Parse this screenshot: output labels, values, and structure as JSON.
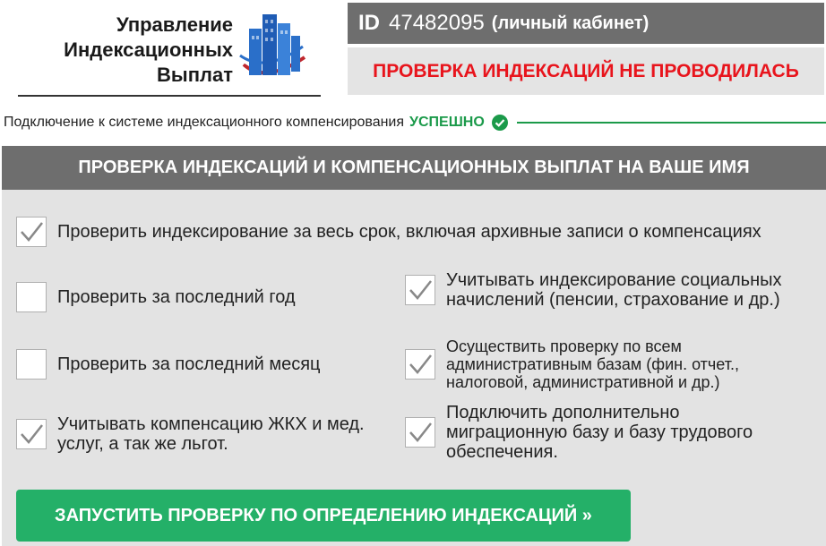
{
  "header": {
    "logo_lines": [
      "Управление",
      "Индексационных",
      "Выплат"
    ],
    "id_label": "ID",
    "id_number": "47482095",
    "cabinet_label": "(личный кабинет)",
    "status_text": "ПРОВЕРКА ИНДЕКСАЦИЙ НЕ ПРОВОДИЛАСЬ"
  },
  "connection": {
    "text": "Подключение к системе индексационного компенсирования",
    "status": "УСПЕШНО"
  },
  "panel": {
    "title": "ПРОВЕРКА ИНДЕКСАЦИЙ И КОМПЕНСАЦИОННЫХ ВЫПЛАТ НА ВАШЕ ИМЯ",
    "options": [
      {
        "label": "Проверить индексирование за весь срок, включая архивные записи о компенсациях",
        "checked": true
      },
      {
        "label": "Проверить за последний год",
        "checked": false
      },
      {
        "label": "Учитывать индексирование социальных начислений (пенсии, страхование и др.)",
        "checked": true
      },
      {
        "label": "Проверить за последний месяц",
        "checked": false
      },
      {
        "label": "Осуществить проверку по всем административным базам (фин. отчет., налоговой, административной и др.)",
        "checked": true
      },
      {
        "label": "Учитывать компенсацию ЖКХ и мед. услуг, а так же льгот.",
        "checked": true
      },
      {
        "label": "Подключить дополнительно миграционную базу и базу трудового обеспечения.",
        "checked": true
      }
    ],
    "run_button": "ЗАПУСТИТЬ ПРОВЕРКУ ПО ОПРЕДЕЛЕНИЮ ИНДЕКСАЦИЙ »"
  },
  "colors": {
    "accent_green": "#24b068",
    "status_red": "#e8141c",
    "header_gray": "#6e6e6e",
    "panel_gray": "#e3e3e3"
  }
}
